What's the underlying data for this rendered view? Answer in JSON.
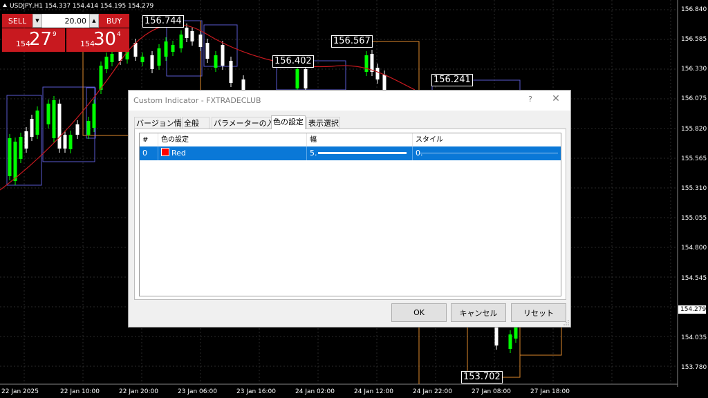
{
  "chart": {
    "symbol_line": "USDJPY,H1  154.337 154.414 154.195 154.279",
    "y_ticks": [
      "156.840",
      "156.585",
      "156.330",
      "156.075",
      "155.820",
      "155.565",
      "155.310",
      "155.055",
      "154.800",
      "154.545",
      "154.279",
      "154.035",
      "153.780"
    ],
    "current_price": "154.279",
    "x_ticks": [
      "22 Jan 2025",
      "22 Jan 10:00",
      "22 Jan 20:00",
      "23 Jan 06:00",
      "23 Jan 16:00",
      "24 Jan 02:00",
      "24 Jan 12:00",
      "24 Jan 22:00",
      "27 Jan 08:00",
      "27 Jan 18:00"
    ],
    "labels": [
      "156.744",
      "156.402",
      "156.567",
      "156.241",
      "153.702"
    ],
    "colors": {
      "bull": "#00ff00",
      "bear": "#ffffff",
      "ma": "#c8191f",
      "box": "#5a5ad0",
      "hline": "#e08a2c"
    }
  },
  "trade": {
    "sell_label": "SELL",
    "buy_label": "BUY",
    "lot": "20.00",
    "sell_small": "154",
    "sell_big": "27",
    "sell_sup": "9",
    "buy_small": "154",
    "buy_big": "30",
    "buy_sup": "4",
    "arrow_down": "▼",
    "arrow_up": "▲"
  },
  "dialog": {
    "title": "Custom Indicator - FXTRADECLUB",
    "help": "?",
    "close": "✕",
    "tabs": [
      "バージョン情報",
      "全般",
      "パラメーターの入力",
      "色の設定",
      "表示選択"
    ],
    "active_tab": "色の設定",
    "columns": [
      "#",
      "色の設定",
      "幅",
      "スタイル"
    ],
    "rows": [
      {
        "index": "0",
        "color_name": "Red",
        "swatch": "#ff0000",
        "width": "5.",
        "style": "0."
      }
    ],
    "buttons": {
      "ok": "OK",
      "cancel": "キャンセル",
      "reset": "リセット"
    }
  }
}
